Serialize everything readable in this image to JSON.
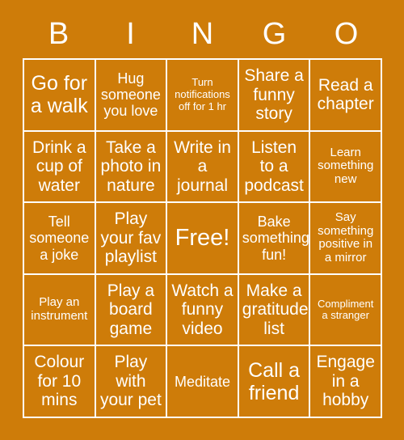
{
  "card": {
    "title_letters": [
      "B",
      "I",
      "N",
      "G",
      "O"
    ],
    "background_color": "#CE7C09",
    "text_color": "#FFFFFF",
    "border_color": "#FFFFFF",
    "grid_size": "5x5",
    "rows": [
      [
        {
          "text": "Go for a walk",
          "size": "xl"
        },
        {
          "text": "Hug someone you love",
          "size": "md"
        },
        {
          "text": "Turn notifications off for 1 hr",
          "size": "xs"
        },
        {
          "text": "Share a funny story",
          "size": "lg"
        },
        {
          "text": "Read a chapter",
          "size": "lg"
        }
      ],
      [
        {
          "text": "Drink a cup of water",
          "size": "lg"
        },
        {
          "text": "Take a photo in nature",
          "size": "lg"
        },
        {
          "text": "Write in a journal",
          "size": "lg"
        },
        {
          "text": "Listen to a podcast",
          "size": "lg"
        },
        {
          "text": "Learn something new",
          "size": "sm"
        }
      ],
      [
        {
          "text": "Tell someone a joke",
          "size": "md"
        },
        {
          "text": "Play your fav playlist",
          "size": "lg"
        },
        {
          "text": "Free!",
          "size": "free"
        },
        {
          "text": "Bake something fun!",
          "size": "md"
        },
        {
          "text": "Say something positive in a mirror",
          "size": "sm"
        }
      ],
      [
        {
          "text": "Play an instrument",
          "size": "sm"
        },
        {
          "text": "Play a board game",
          "size": "lg"
        },
        {
          "text": "Watch a funny video",
          "size": "lg"
        },
        {
          "text": "Make a gratitude list",
          "size": "lg"
        },
        {
          "text": "Compliment a stranger",
          "size": "xs"
        }
      ],
      [
        {
          "text": "Colour for 10 mins",
          "size": "lg"
        },
        {
          "text": "Play with your pet",
          "size": "lg"
        },
        {
          "text": "Meditate",
          "size": "md"
        },
        {
          "text": "Call a friend",
          "size": "xl"
        },
        {
          "text": "Engage in a hobby",
          "size": "lg"
        }
      ]
    ]
  }
}
